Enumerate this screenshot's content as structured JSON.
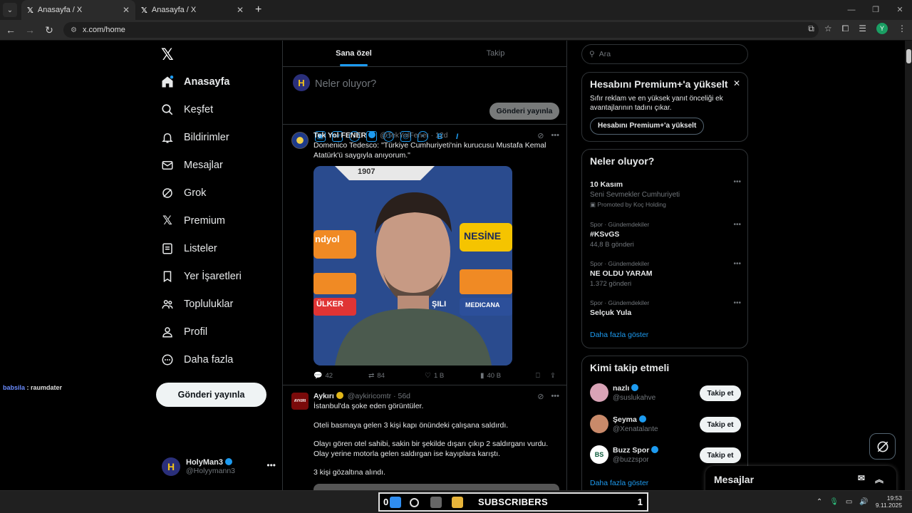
{
  "browser": {
    "tabs": [
      {
        "title": "Anasayfa / X",
        "icon": "x-favicon"
      },
      {
        "title": "Anasayfa / X",
        "icon": "x-favicon"
      }
    ],
    "url": "x.com/home"
  },
  "nav": {
    "items": [
      {
        "label": "Anasayfa",
        "icon": "home-icon"
      },
      {
        "label": "Keşfet",
        "icon": "search-icon"
      },
      {
        "label": "Bildirimler",
        "icon": "bell-icon"
      },
      {
        "label": "Mesajlar",
        "icon": "mail-icon"
      },
      {
        "label": "Grok",
        "icon": "grok-icon"
      },
      {
        "label": "Premium",
        "icon": "x-icon"
      },
      {
        "label": "Listeler",
        "icon": "list-icon"
      },
      {
        "label": "Yer İşaretleri",
        "icon": "bookmark-icon"
      },
      {
        "label": "Topluluklar",
        "icon": "communities-icon"
      },
      {
        "label": "Profil",
        "icon": "profile-icon"
      },
      {
        "label": "Daha fazla",
        "icon": "more-circle-icon"
      }
    ],
    "post_button": "Gönderi yayınla",
    "account": {
      "name": "HolyMan3",
      "handle": "@Holyymann3",
      "avatar_letter": "H"
    }
  },
  "side_chat": {
    "user": "babsila",
    "text": ": raumdater"
  },
  "feed": {
    "tabs": [
      "Sana özel",
      "Takip"
    ],
    "compose": {
      "placeholder": "Neler oluyor?",
      "publish": "Gönderi yayınla"
    },
    "tweets": [
      {
        "name": "Tek Yol FENER",
        "handle": "@TekYolFener",
        "time": "· 12d",
        "text": "Domenico Tedesco: \"Türkiye Cumhuriyeti'nin kurucusu Mustafa Kemal Atatürk'ü saygıyla anıyorum.\"",
        "stats": {
          "replies": "42",
          "retweets": "84",
          "likes": "1 B",
          "views": "40 B"
        },
        "media_words": {
          "top": "1907",
          "a": "ndyol",
          "b": "NESİNE",
          "c": "ÜLKER",
          "d": "MEDICANA",
          "e": "ŞILI"
        }
      },
      {
        "name": "Aykırı",
        "handle": "@aykiricomtr",
        "time": "· 56d",
        "avatar_text": "AYKIRI",
        "lines": [
          "İstanbul'da şoke eden görüntüler.",
          "Oteli basmaya gelen 3 kişi kapı önündeki çalışana saldırdı.",
          "Olayı gören otel sahibi, sakin bir şekilde dışarı çıkıp 2 saldırganı vurdu. Olay yerine motorla gelen saldırgan ise kayıplara karıştı.",
          "3 kişi gözaltına alındı."
        ]
      }
    ]
  },
  "right": {
    "search_placeholder": "Ara",
    "premium": {
      "title": "Hesabını Premium+'a yükselt",
      "text": "Sıfır reklam ve en yüksek yanıt önceliği ek avantajlarının tadını çıkar.",
      "button": "Hesabını Premium+'a yükselt"
    },
    "trends": {
      "title": "Neler oluyor?",
      "items": [
        {
          "category": "",
          "title": "10 Kasım",
          "sub": "Seni Sevmekler Cumhuriyeti",
          "extra": "Promoted by Koç Holding"
        },
        {
          "category": "Spor · Gündemdekiler",
          "title": "#KSvGS",
          "sub": "44,8 B gönderi",
          "extra": ""
        },
        {
          "category": "Spor · Gündemdekiler",
          "title": "NE OLDU YARAM",
          "sub": "1.372 gönderi",
          "extra": ""
        },
        {
          "category": "Spor · Gündemdekiler",
          "title": "Selçuk Yula",
          "sub": "",
          "extra": ""
        }
      ],
      "more": "Daha fazla göster"
    },
    "who": {
      "title": "Kimi takip etmeli",
      "items": [
        {
          "name": "nazlı",
          "handle": "@suslukahve",
          "button": "Takip et",
          "color": "#d9a3b6"
        },
        {
          "name": "Şeyma",
          "handle": "@Xenatalante",
          "button": "Takip et",
          "color": "#c98a6a"
        },
        {
          "name": "Buzz Spor",
          "handle": "@buzzspor",
          "button": "Takip et",
          "color": "#ffffff"
        }
      ],
      "more": "Daha fazla göster"
    },
    "messages": "Mesajlar"
  },
  "taskbar": {
    "overlay_left": "0",
    "overlay_label": "SUBSCRIBERS",
    "overlay_right": "1",
    "time": "19:53",
    "date": "9.11.2025"
  },
  "colors": {
    "accent": "#1d9bf0",
    "background": "#000000",
    "border": "#2f3336"
  }
}
